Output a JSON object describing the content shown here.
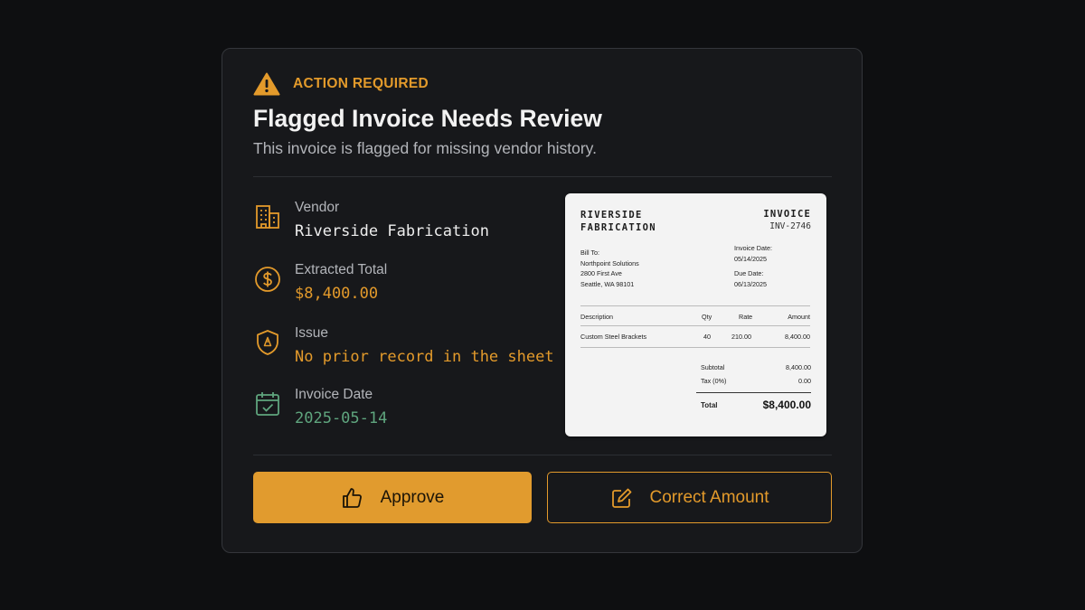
{
  "alert": {
    "label": "ACTION REQUIRED",
    "title": "Flagged Invoice Needs Review",
    "subtitle": "This invoice is flagged for missing vendor history."
  },
  "fields": [
    {
      "icon": "building-icon",
      "label": "Vendor",
      "value": "Riverside Fabrication"
    },
    {
      "icon": "dollar-circle-icon",
      "label": "Extracted Total",
      "value": "$8,400.00"
    },
    {
      "icon": "shield-alert-icon",
      "label": "Issue",
      "value": "No prior record in the sheet"
    },
    {
      "icon": "calendar-check-icon",
      "label": "Invoice Date",
      "value": "2025-05-14"
    }
  ],
  "invoice": {
    "vendor_line1": "RIVERSIDE",
    "vendor_line2": "FABRICATION",
    "doc_type": "INVOICE",
    "number": "INV-2746",
    "bill_to_label": "Bill To:",
    "bill_to_name": "Northpoint Solutions",
    "bill_to_street": "2800 First Ave",
    "bill_to_city": "Seattle, WA 98101",
    "invoice_date_label": "Invoice Date:",
    "invoice_date": "05/14/2025",
    "due_date_label": "Due Date:",
    "due_date": "06/13/2025",
    "columns": [
      "Description",
      "Qty",
      "Rate",
      "Amount"
    ],
    "items": [
      {
        "description": "Custom Steel Brackets",
        "qty": "40",
        "rate": "210.00",
        "amount": "8,400.00"
      }
    ],
    "subtotal_label": "Subtotal",
    "subtotal": "8,400.00",
    "tax_label": "Tax (0%)",
    "tax": "0.00",
    "total_label": "Total",
    "total": "$8,400.00"
  },
  "actions": {
    "approve_label": "Approve",
    "correct_label": "Correct Amount"
  },
  "colors": {
    "accent": "#e39a2b",
    "date_green": "#5fa57e",
    "background": "#0e0f11",
    "card": "#17181b"
  }
}
